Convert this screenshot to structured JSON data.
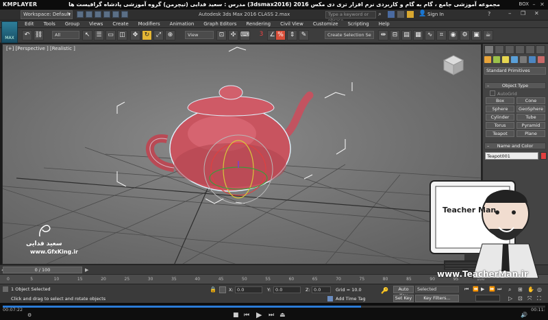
{
  "player": {
    "logo": "KMPLAYER",
    "course_title": "مجموعه آموزشی جامع ، گام به گام و کاربردی نرم افزار تری دی مکس 2016 (3dsmax2016) مدرس : سعید فدایی (تیچرمن) گروه آموزشی پادشاه گرافیست ها",
    "box_label": "BOX",
    "elapsed": "00:07:22",
    "duration": "00:11:",
    "progress": 0.66
  },
  "titlebar": {
    "workspace": "Workspace: Default",
    "app_title": "Autodesk 3ds Max 2016    CLASS 2.max",
    "search_placeholder": "Type a keyword or phrase",
    "signin": "Sign In"
  },
  "menu": [
    "Edit",
    "Tools",
    "Group",
    "Views",
    "Create",
    "Modifiers",
    "Animation",
    "Graph Editors",
    "Rendering",
    "Civil View",
    "Customize",
    "Scripting",
    "Help"
  ],
  "toolbar": {
    "filter": "All",
    "ref_coord": "View",
    "snap_number": "3",
    "selection_set": "Create Selection Se"
  },
  "max_logo": "MAX",
  "viewport": {
    "label": "[+] [Perspective ] [Realistic ]"
  },
  "command_panel": {
    "category": "Standard Primitives",
    "object_type_header": "Object Type",
    "autogrid": "AutoGrid",
    "buttons": [
      "Box",
      "Cone",
      "Sphere",
      "GeoSphere",
      "Cylinder",
      "Tube",
      "Torus",
      "Pyramid",
      "Teapot",
      "Plane"
    ],
    "name_color_header": "Name and Color",
    "object_name": "Teapot001",
    "object_color": "#e0403f"
  },
  "watermark": {
    "name": "سعید فدایی",
    "url": "www.GfxKing.ir"
  },
  "teacher": {
    "brand": "Teacher Man",
    "url": "www.TeacherMan.ir"
  },
  "timeline": {
    "frame_counter": "0 / 100",
    "ticks": [
      "0",
      "5",
      "10",
      "15",
      "20",
      "25",
      "30",
      "35",
      "40",
      "45",
      "50",
      "55",
      "60",
      "65",
      "70",
      "75",
      "80",
      "85",
      "90",
      "95",
      "100"
    ]
  },
  "status": {
    "selected": "1 Object Selected",
    "prompt": "Click and drag to select and rotate objects",
    "x_label": "X:",
    "x_value": "0.0",
    "y_label": "Y:",
    "y_value": "0.0",
    "z_label": "Z:",
    "z_value": "0.0",
    "grid": "Grid = 10.0",
    "add_time_tag": "Add Time Tag",
    "auto_key": "Auto Key",
    "set_key": "Set Key",
    "selected_dropdown": "Selected",
    "key_filters": "Key Filters..."
  }
}
